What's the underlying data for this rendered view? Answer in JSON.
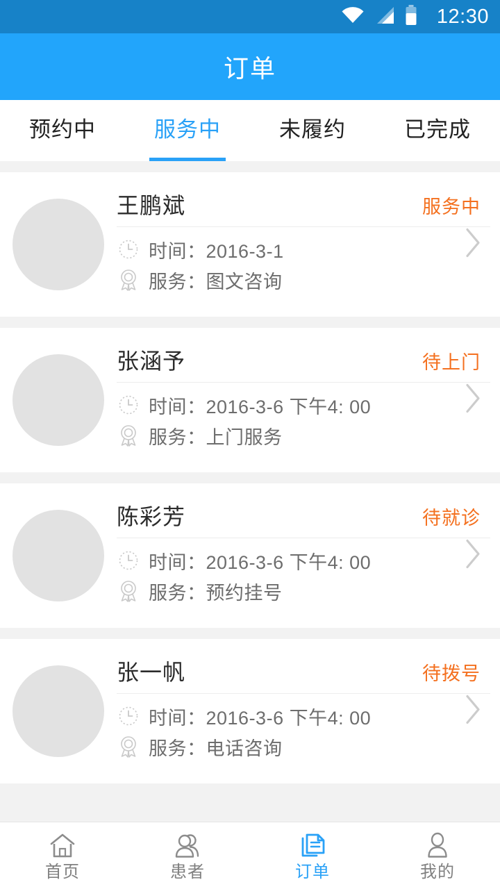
{
  "status_bar": {
    "time": "12:30",
    "icons": [
      "wifi-icon",
      "cellular-signal-icon",
      "battery-icon"
    ],
    "background_color": "#1782c8"
  },
  "header": {
    "title": "订单",
    "background_color": "#22a5fb"
  },
  "tabs": {
    "active_index": 1,
    "accent_color": "#29a1f7",
    "items": [
      {
        "label": "预约中"
      },
      {
        "label": "服务中"
      },
      {
        "label": "未履约"
      },
      {
        "label": "已完成"
      }
    ]
  },
  "list": {
    "time_label": "时间：",
    "service_label": "服务：",
    "status_color": "#f4701f",
    "orders": [
      {
        "name": "王鹏斌",
        "status": "服务中",
        "time": "2016-3-1",
        "service": "图文咨询"
      },
      {
        "name": "张涵予",
        "status": "待上门",
        "time": "2016-3-6 下午4: 00",
        "service": "上门服务"
      },
      {
        "name": "陈彩芳",
        "status": "待就诊",
        "time": "2016-3-6 下午4: 00",
        "service": "预约挂号"
      },
      {
        "name": "张一帆",
        "status": "待拨号",
        "time": "2016-3-6 下午4: 00",
        "service": "电话咨询"
      }
    ]
  },
  "bottom_nav": {
    "active_index": 2,
    "active_color": "#29a1f7",
    "inactive_color": "#808080",
    "items": [
      {
        "label": "首页",
        "icon": "home-icon"
      },
      {
        "label": "患者",
        "icon": "patients-icon"
      },
      {
        "label": "订单",
        "icon": "orders-document-icon"
      },
      {
        "label": "我的",
        "icon": "profile-person-icon"
      }
    ]
  }
}
